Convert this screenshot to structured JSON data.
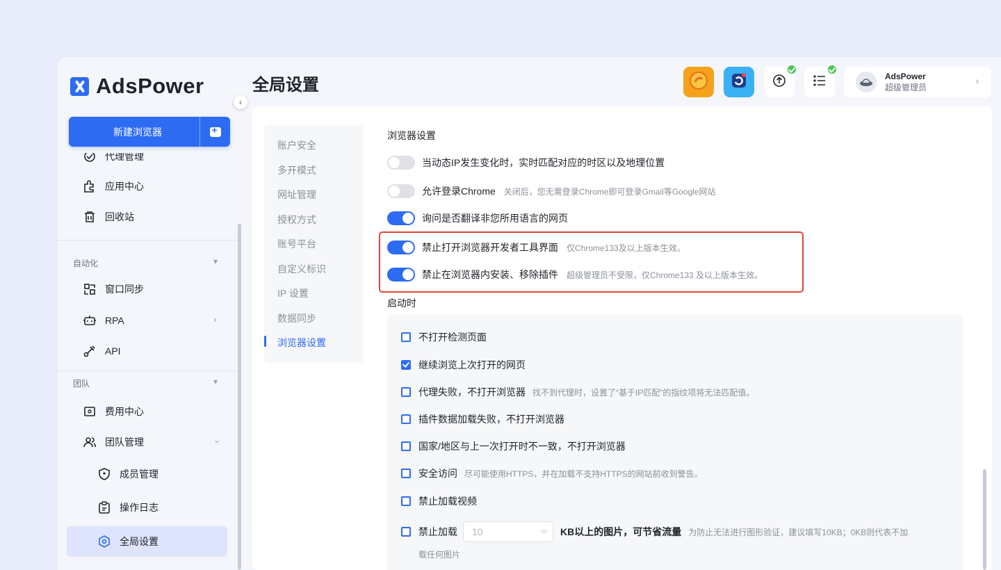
{
  "brand": {
    "name": "AdsPower"
  },
  "sidebar": {
    "new_browser": "新建浏览器",
    "items": [
      {
        "label": "代理管理"
      },
      {
        "label": "应用中心"
      },
      {
        "label": "回收站"
      }
    ],
    "automation": {
      "title": "自动化",
      "items": [
        {
          "label": "窗口同步"
        },
        {
          "label": "RPA"
        },
        {
          "label": "API"
        }
      ]
    },
    "team": {
      "title": "团队",
      "items": [
        {
          "label": "费用中心"
        },
        {
          "label": "团队管理"
        },
        {
          "label": "成员管理"
        },
        {
          "label": "操作日志"
        },
        {
          "label": "全局设置"
        }
      ]
    }
  },
  "header": {
    "title": "全局设置",
    "user": {
      "name": "AdsPower",
      "role": "超级管理员"
    }
  },
  "subnav": [
    "账户安全",
    "多开模式",
    "网址管理",
    "授权方式",
    "账号平台",
    "自定义标识",
    "IP 设置",
    "数据同步",
    "浏览器设置"
  ],
  "browser_settings": {
    "title": "浏览器设置",
    "toggles": [
      {
        "label": "当动态IP发生变化时，实时匹配对应的时区以及地理位置",
        "hint": "",
        "on": false
      },
      {
        "label": "允许登录Chrome",
        "hint": "关闭后，您无需登录Chrome即可登录Gmail等Google网站",
        "on": false
      },
      {
        "label": "询问是否翻译非您所用语言的网页",
        "hint": "",
        "on": true
      },
      {
        "label": "禁止打开浏览器开发者工具界面",
        "hint": "仅Chrome133及以上版本生效。",
        "on": true
      },
      {
        "label": "禁止在浏览器内安装、移除插件",
        "hint": "超级管理员不受限，仅Chrome133 及以上版本生效。",
        "on": true
      }
    ]
  },
  "startup": {
    "title": "启动时",
    "options": [
      {
        "label": "不打开检测页面",
        "hint": "",
        "checked": false
      },
      {
        "label": "继续浏览上次打开的网页",
        "hint": "",
        "checked": true
      },
      {
        "label": "代理失败，不打开浏览器",
        "hint": "找不到代理时，设置了“基于IP匹配”的指纹项将无法匹配值。",
        "checked": false
      },
      {
        "label": "插件数据加载失败，不打开浏览器",
        "hint": "",
        "checked": false
      },
      {
        "label": "国家/地区与上一次打开时不一致，不打开浏览器",
        "hint": "",
        "checked": false
      },
      {
        "label": "安全访问",
        "hint": "尽可能使用HTTPS，并在加载不支持HTTPS的网站前收到警告。",
        "checked": false
      },
      {
        "label": "禁止加载视频",
        "hint": "",
        "checked": false
      }
    ],
    "image_limit": {
      "prefix": "禁止加载",
      "value": "10",
      "suffix": "KB以上的图片，可节省流量",
      "hint_line1": "为防止无法进行图形验证，建议填写10KB；0KB则代表不加",
      "hint_line2": "载任何图片",
      "checked": false
    }
  }
}
